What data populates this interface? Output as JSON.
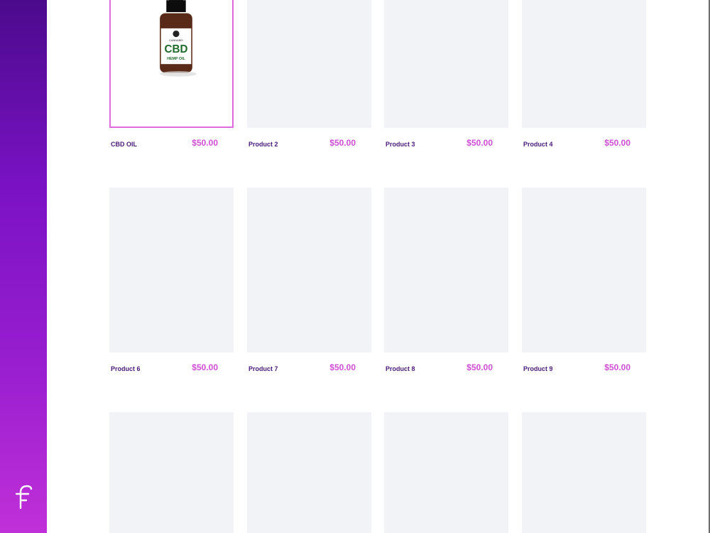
{
  "products": [
    {
      "name": "CBD OIL",
      "price": "$50.00",
      "has_image": true
    },
    {
      "name": "Product 2",
      "price": "$50.00",
      "has_image": false
    },
    {
      "name": "Product 3",
      "price": "$50.00",
      "has_image": false
    },
    {
      "name": "Product 4",
      "price": "$50.00",
      "has_image": false
    },
    {
      "name": "Product 6",
      "price": "$50.00",
      "has_image": false
    },
    {
      "name": "Product 7",
      "price": "$50.00",
      "has_image": false
    },
    {
      "name": "Product 8",
      "price": "$50.00",
      "has_image": false
    },
    {
      "name": "Product 9",
      "price": "$50.00",
      "has_image": false
    }
  ],
  "bottle_label": {
    "brand": "CANNABIS",
    "title": "CBD",
    "subtitle": "HEMP OIL"
  },
  "colors": {
    "accent": "#d04fd6",
    "name_text": "#4a1a7a",
    "placeholder": "#f2f3f6",
    "selected_border": "#e06be0"
  },
  "icons": {
    "sidebar_logo": "f-logo-icon"
  }
}
